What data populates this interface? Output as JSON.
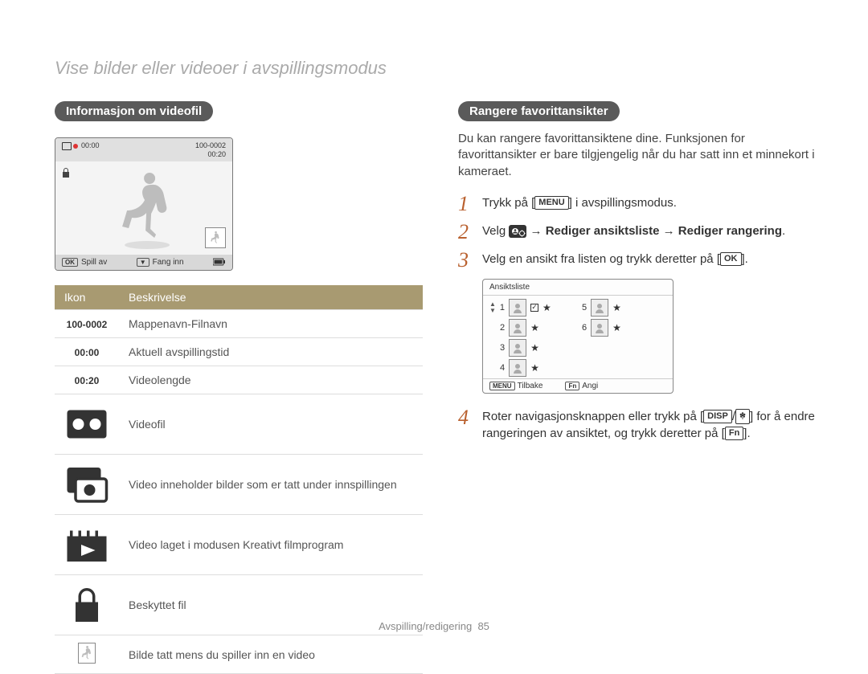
{
  "page_title": "Vise bilder eller videoer i avspillingsmodus",
  "left": {
    "heading": "Informasjon om videofil",
    "lcd": {
      "folder_file": "100-0002",
      "time_current": "00:00",
      "time_length": "00:20",
      "play_label": "Spill av",
      "capture_label": "Fang inn",
      "ok_key": "OK"
    },
    "table": {
      "th_icon": "Ikon",
      "th_desc": "Beskrivelse",
      "rows": [
        {
          "icon": "100-0002",
          "type": "text",
          "desc": "Mappenavn-Filnavn"
        },
        {
          "icon": "00:00",
          "type": "text",
          "desc": "Aktuell avspillingstid"
        },
        {
          "icon": "00:20",
          "type": "text",
          "desc": "Videolengde"
        },
        {
          "icon": "videofile",
          "type": "svg",
          "desc": "Videofil"
        },
        {
          "icon": "dualcapture",
          "type": "svg",
          "desc": "Video inneholder bilder som er tatt under innspillingen"
        },
        {
          "icon": "creative",
          "type": "svg",
          "desc": "Video laget i modusen Kreativt filmprogram"
        },
        {
          "icon": "lock",
          "type": "svg",
          "desc": "Beskyttet fil"
        },
        {
          "icon": "skater",
          "type": "svg",
          "desc": "Bilde tatt mens du spiller inn en video"
        }
      ]
    }
  },
  "right": {
    "heading": "Rangere favorittansikter",
    "intro": "Du kan rangere favorittansiktene dine. Funksjonen for favorittansikter er bare tilgjengelig når du har satt inn et minnekort i kameraet.",
    "steps": {
      "s1_a": "Trykk på [",
      "s1_badge": "MENU",
      "s1_b": "] i avspillingsmodus.",
      "s2_a": "Velg ",
      "s2_b": " → ",
      "s2_c": "Rediger ansiktsliste",
      "s2_d": " → ",
      "s2_e": "Rediger rangering",
      "s2_f": ".",
      "s3_a": "Velg en ansikt fra listen og trykk deretter på [",
      "s3_badge": "OK",
      "s3_b": "].",
      "s4_a": "Roter navigasjonsknappen eller trykk på [",
      "s4_badge1": "DISP",
      "s4_slash": "/",
      "s4_badge2_icon": "flower",
      "s4_b": "] for å endre rangeringen av ansiktet, og trykk deretter på [",
      "s4_badge3": "Fn",
      "s4_c": "]."
    },
    "facelist": {
      "title": "Ansiktsliste",
      "items": [
        {
          "n": "1",
          "check": true
        },
        {
          "n": "5"
        },
        {
          "n": "2"
        },
        {
          "n": "6"
        },
        {
          "n": "3"
        },
        {
          "n": "4"
        }
      ],
      "back_key": "MENU",
      "back_label": "Tilbake",
      "set_key": "Fn",
      "set_label": "Angi"
    }
  },
  "footer": {
    "section": "Avspilling/redigering",
    "page": "85"
  }
}
